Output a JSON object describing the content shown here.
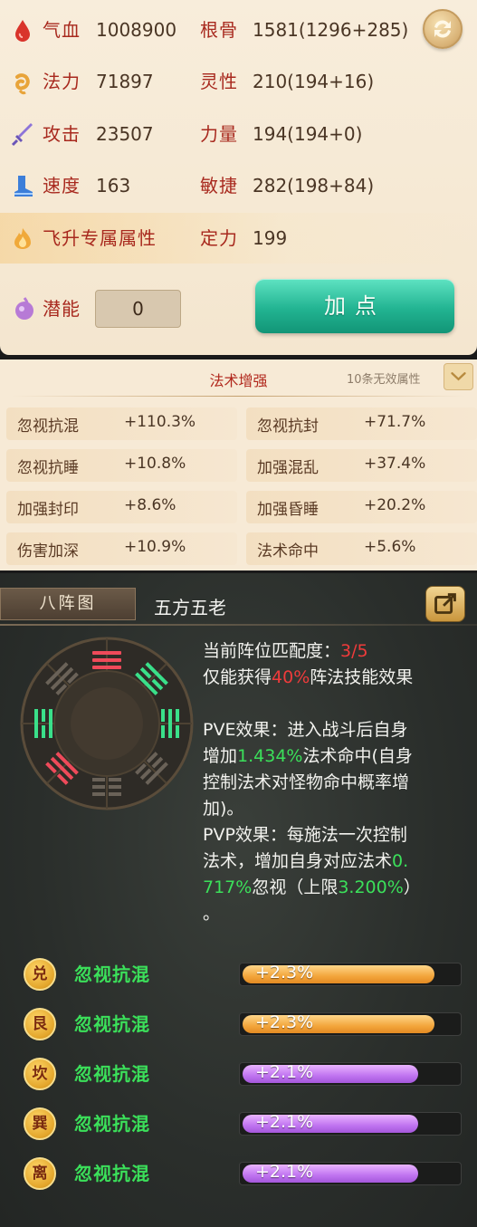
{
  "attributes": {
    "rows": [
      {
        "label": "气血",
        "value": "1008900",
        "label2": "根骨",
        "value2": "1581(1296+285)",
        "icon": "blood-drop-icon"
      },
      {
        "label": "法力",
        "value": "71897",
        "label2": "灵性",
        "value2": "210(194+16)",
        "icon": "mana-swirl-icon"
      },
      {
        "label": "攻击",
        "value": "23507",
        "label2": "力量",
        "value2": "194(194+0)",
        "icon": "sword-icon"
      },
      {
        "label": "速度",
        "value": "163",
        "label2": "敏捷",
        "value2": "282(198+84)",
        "icon": "boot-icon"
      },
      {
        "label": "飞升专属属性",
        "value": "",
        "label2": "定力",
        "value2": "199",
        "icon": "ascension-flame-icon"
      }
    ],
    "potential": {
      "label": "潜能",
      "value": "0",
      "icon": "potential-orb-icon"
    },
    "add_points_label": "加点",
    "refresh_icon": "refresh-icon",
    "colors": {
      "label": "#a8291e",
      "accent_button": "#22b492"
    }
  },
  "spell_enhance": {
    "title": "法术增强",
    "invalid_count": "10条无效属性",
    "cells": [
      {
        "name": "忽视抗混",
        "value": "+110.3%"
      },
      {
        "name": "忽视抗封",
        "value": "+71.7%"
      },
      {
        "name": "忽视抗睡",
        "value": "+10.8%"
      },
      {
        "name": "加强混乱",
        "value": "+37.4%"
      },
      {
        "name": "加强封印",
        "value": "+8.6%"
      },
      {
        "name": "加强昏睡",
        "value": "+20.2%"
      },
      {
        "name": "伤害加深",
        "value": "+10.9%"
      },
      {
        "name": "法术命中",
        "value": "+5.6%"
      }
    ]
  },
  "formation": {
    "tab_label": "八阵图",
    "name": "五方五老",
    "match_label": "当前阵位匹配度：",
    "match_value": "3/5",
    "gain_prefix": "仅能获得",
    "gain_value": "40%",
    "gain_suffix": "阵法技能效果",
    "pve_line1": "PVE效果：进入战斗后自身",
    "pve_line2_prefix": "增加",
    "pve_line2_value": "1.434%",
    "pve_line2_suffix": "法术命中(自身",
    "pve_line3": "控制法术对怪物命中概率增",
    "pve_line4": "加)。",
    "pvp_line1": "PVP效果：每施法一次控制",
    "pvp_line2_prefix": "法术，增加自身对应法术",
    "pvp_line2_value": "0.",
    "pvp_line3_value": "717%",
    "pvp_line3_mid": "忽视（上限",
    "pvp_line3_cap": "3.200%",
    "pvp_line3_end": "）",
    "pvp_line4": "。",
    "effects": [
      {
        "badge": "兑",
        "name": "忽视抗混",
        "value": "+2.3%",
        "level": 0.9,
        "color": "orange"
      },
      {
        "badge": "艮",
        "name": "忽视抗混",
        "value": "+2.3%",
        "level": 0.9,
        "color": "orange"
      },
      {
        "badge": "坎",
        "name": "忽视抗混",
        "value": "+2.1%",
        "level": 0.82,
        "color": "purple"
      },
      {
        "badge": "巽",
        "name": "忽视抗混",
        "value": "+2.1%",
        "level": 0.82,
        "color": "purple"
      },
      {
        "badge": "离",
        "name": "忽视抗混",
        "value": "+2.1%",
        "level": 0.82,
        "color": "purple"
      }
    ],
    "share_icon": "share-icon",
    "colors": {
      "highlight_red": "#ef3b3b",
      "highlight_green": "#3be05a"
    }
  }
}
